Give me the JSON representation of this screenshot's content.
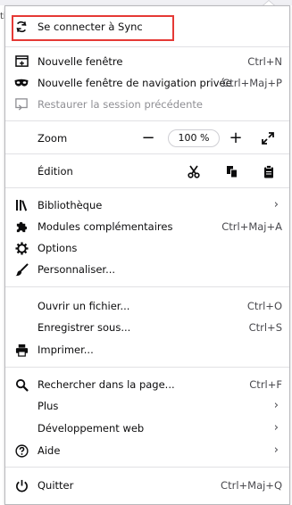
{
  "background": {
    "left_stub_text": "ti"
  },
  "colors": {
    "highlight": "#e53935",
    "separator": "#e1e1e4",
    "disabled": "#8f8f94"
  },
  "sync": {
    "label": "Se connecter à Sync",
    "icon": "sync-icon"
  },
  "window": {
    "new_window": {
      "label": "Nouvelle fenêtre",
      "shortcut": "Ctrl+N",
      "icon": "new-window-icon"
    },
    "private_window": {
      "label": "Nouvelle fenêtre de navigation privée",
      "shortcut": "Ctrl+Maj+P",
      "icon": "mask-icon"
    },
    "restore_session": {
      "label": "Restaurer la session précédente",
      "icon": "restore-icon"
    }
  },
  "zoom": {
    "label": "Zoom",
    "value": "100 %",
    "minus": "−",
    "plus": "+"
  },
  "edit": {
    "label": "Édition"
  },
  "library": {
    "bibliotheque": {
      "label": "Bibliothèque",
      "icon": "library-icon"
    },
    "modules": {
      "label": "Modules complémentaires",
      "shortcut": "Ctrl+Maj+A",
      "icon": "puzzle-icon"
    },
    "options": {
      "label": "Options",
      "icon": "gear-icon"
    },
    "personnaliser": {
      "label": "Personnaliser...",
      "icon": "paintbrush-icon"
    }
  },
  "file": {
    "open": {
      "label": "Ouvrir un fichier...",
      "shortcut": "Ctrl+O"
    },
    "save": {
      "label": "Enregistrer sous...",
      "shortcut": "Ctrl+S"
    },
    "print": {
      "label": "Imprimer...",
      "icon": "printer-icon"
    }
  },
  "tools": {
    "find": {
      "label": "Rechercher dans la page...",
      "shortcut": "Ctrl+F",
      "icon": "search-icon"
    },
    "more": {
      "label": "Plus"
    },
    "webdev": {
      "label": "Développement web"
    },
    "help": {
      "label": "Aide",
      "icon": "help-icon"
    }
  },
  "quit": {
    "label": "Quitter",
    "shortcut": "Ctrl+Maj+Q",
    "icon": "power-icon"
  }
}
